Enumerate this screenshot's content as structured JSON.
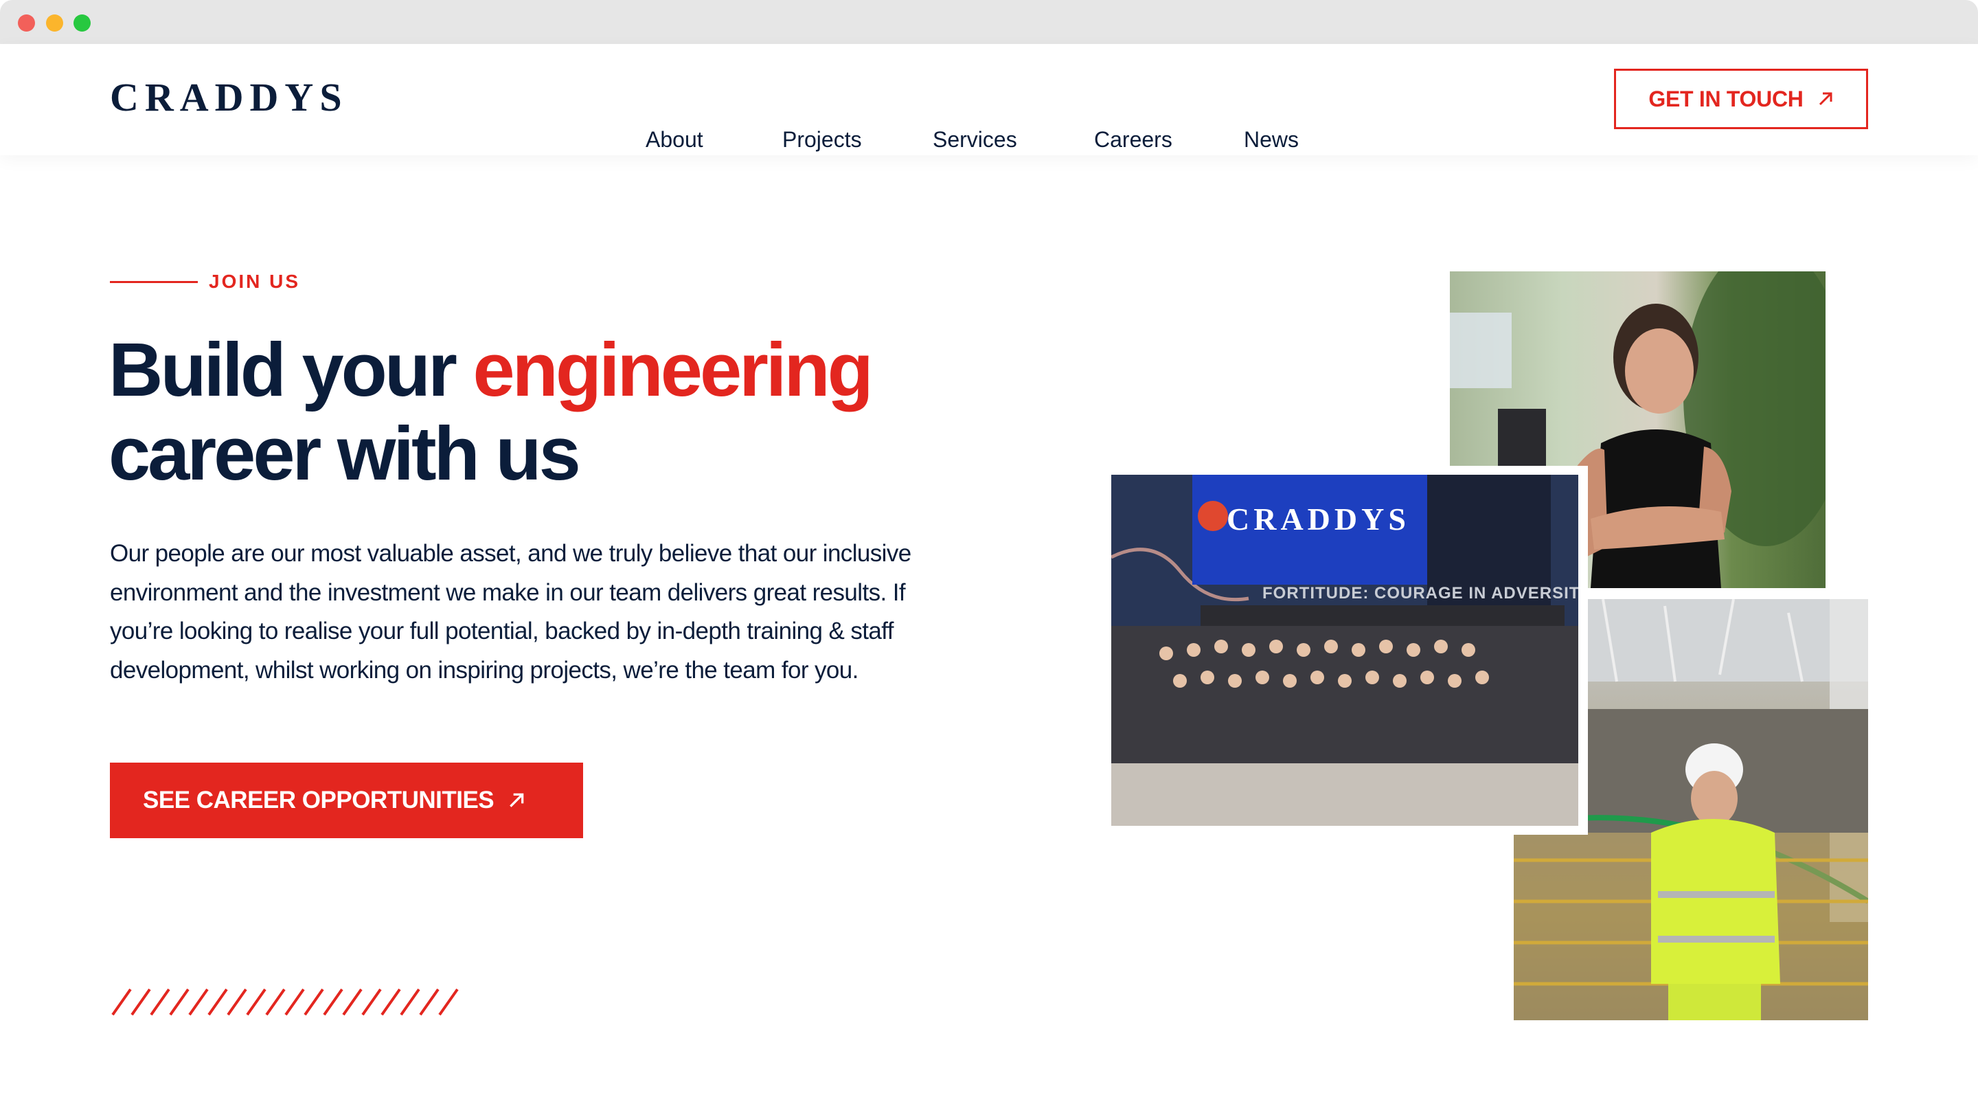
{
  "window": {
    "controls": [
      "close",
      "minimize",
      "maximize"
    ]
  },
  "header": {
    "logo": "CRADDYS",
    "nav": [
      {
        "label": "About"
      },
      {
        "label": "Projects"
      },
      {
        "label": "Services"
      },
      {
        "label": "Careers"
      },
      {
        "label": "News"
      }
    ],
    "cta_label": "GET IN TOUCH",
    "cta_icon": "arrow-up-right-icon"
  },
  "hero": {
    "eyebrow": "JOIN US",
    "headline_part1": "Build your ",
    "headline_accent": "engineering",
    "headline_part2": "career with us",
    "body": "Our people are our most valuable asset, and we truly believe that our inclusive environment and the investment we make in our team delivers great results. If you’re looking to realise your full potential, backed by in-depth training & staff development, whilst working on inspiring projects, we’re the team for you.",
    "button_label": "SEE CAREER OPPORTUNITIES",
    "button_icon": "arrow-up-right-icon",
    "decoration_slash_count": 18
  },
  "photos": {
    "woman": {
      "alt": "Smiling team member in an office with a plant"
    },
    "group": {
      "alt": "Company team photo at Christmas event",
      "screen_text": "CRADDYS",
      "banner_text": "FORTITUDE: COURAGE IN ADVERSITY"
    },
    "worker": {
      "alt": "Engineer in hi-vis jacket and hard hat on construction site"
    }
  },
  "colors": {
    "brand_navy": "#0b1d3a",
    "accent_red": "#e3261f"
  }
}
